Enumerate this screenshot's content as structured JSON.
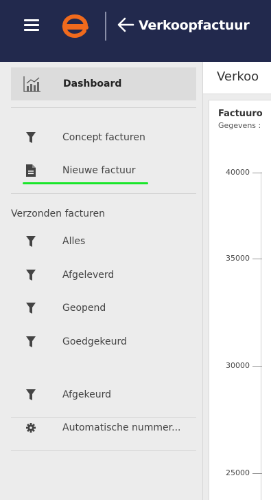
{
  "header": {
    "title": "Verkoopfactuur",
    "brand_color": "#22294d",
    "logo_color": "#f06a1d"
  },
  "sidebar": {
    "dashboard_label": "Dashboard",
    "items_top": [
      {
        "label": "Concept facturen",
        "icon": "filter-icon"
      },
      {
        "label": "Nieuwe factuur",
        "icon": "document-icon"
      }
    ],
    "section_label": "Verzonden facturen",
    "items_sent": [
      {
        "label": "Alles",
        "icon": "filter-icon"
      },
      {
        "label": "Afgeleverd",
        "icon": "filter-icon"
      },
      {
        "label": "Geopend",
        "icon": "filter-icon"
      },
      {
        "label": "Goedgekeurd",
        "icon": "filter-icon"
      },
      {
        "label": "Afgekeurd",
        "icon": "filter-icon"
      }
    ],
    "settings_label": "Automatische nummer...",
    "highlight_color": "#19e62a"
  },
  "main": {
    "page_title": "Verkoo",
    "card_title": "Factuuro",
    "card_subtitle": "Gegevens :",
    "y_ticks": [
      "40000",
      "35000",
      "30000",
      "25000"
    ]
  }
}
